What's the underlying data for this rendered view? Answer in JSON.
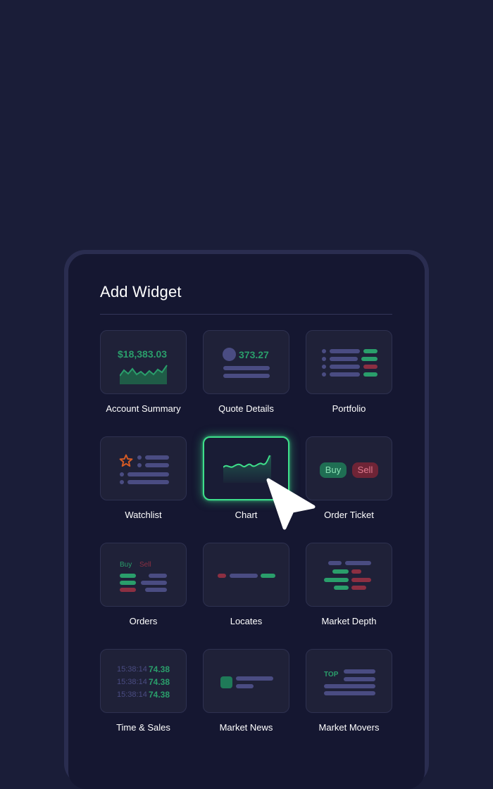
{
  "dialog": {
    "title": "Add Widget"
  },
  "widgets": [
    {
      "label": "Account Summary",
      "preview_value": "$18,383.03"
    },
    {
      "label": "Quote Details",
      "preview_value": "373.27"
    },
    {
      "label": "Portfolio"
    },
    {
      "label": "Watchlist"
    },
    {
      "label": "Chart",
      "selected": true
    },
    {
      "label": "Order Ticket",
      "buy_label": "Buy",
      "sell_label": "Sell"
    },
    {
      "label": "Orders",
      "buy_label": "Buy",
      "sell_label": "Sell"
    },
    {
      "label": "Locates"
    },
    {
      "label": "Market Depth"
    },
    {
      "label": "Time & Sales",
      "rows": [
        {
          "time": "15:38:14",
          "price": "74.38"
        },
        {
          "time": "15:38:14",
          "price": "74.38"
        },
        {
          "time": "15:38:14",
          "price": "74.38"
        }
      ]
    },
    {
      "label": "Market News"
    },
    {
      "label": "Market Movers",
      "badge": "TOP"
    }
  ],
  "colors": {
    "accent_green": "#3ee08b",
    "positive": "#2a9e6b",
    "negative": "#8c2f42",
    "background": "#1a1d38"
  }
}
